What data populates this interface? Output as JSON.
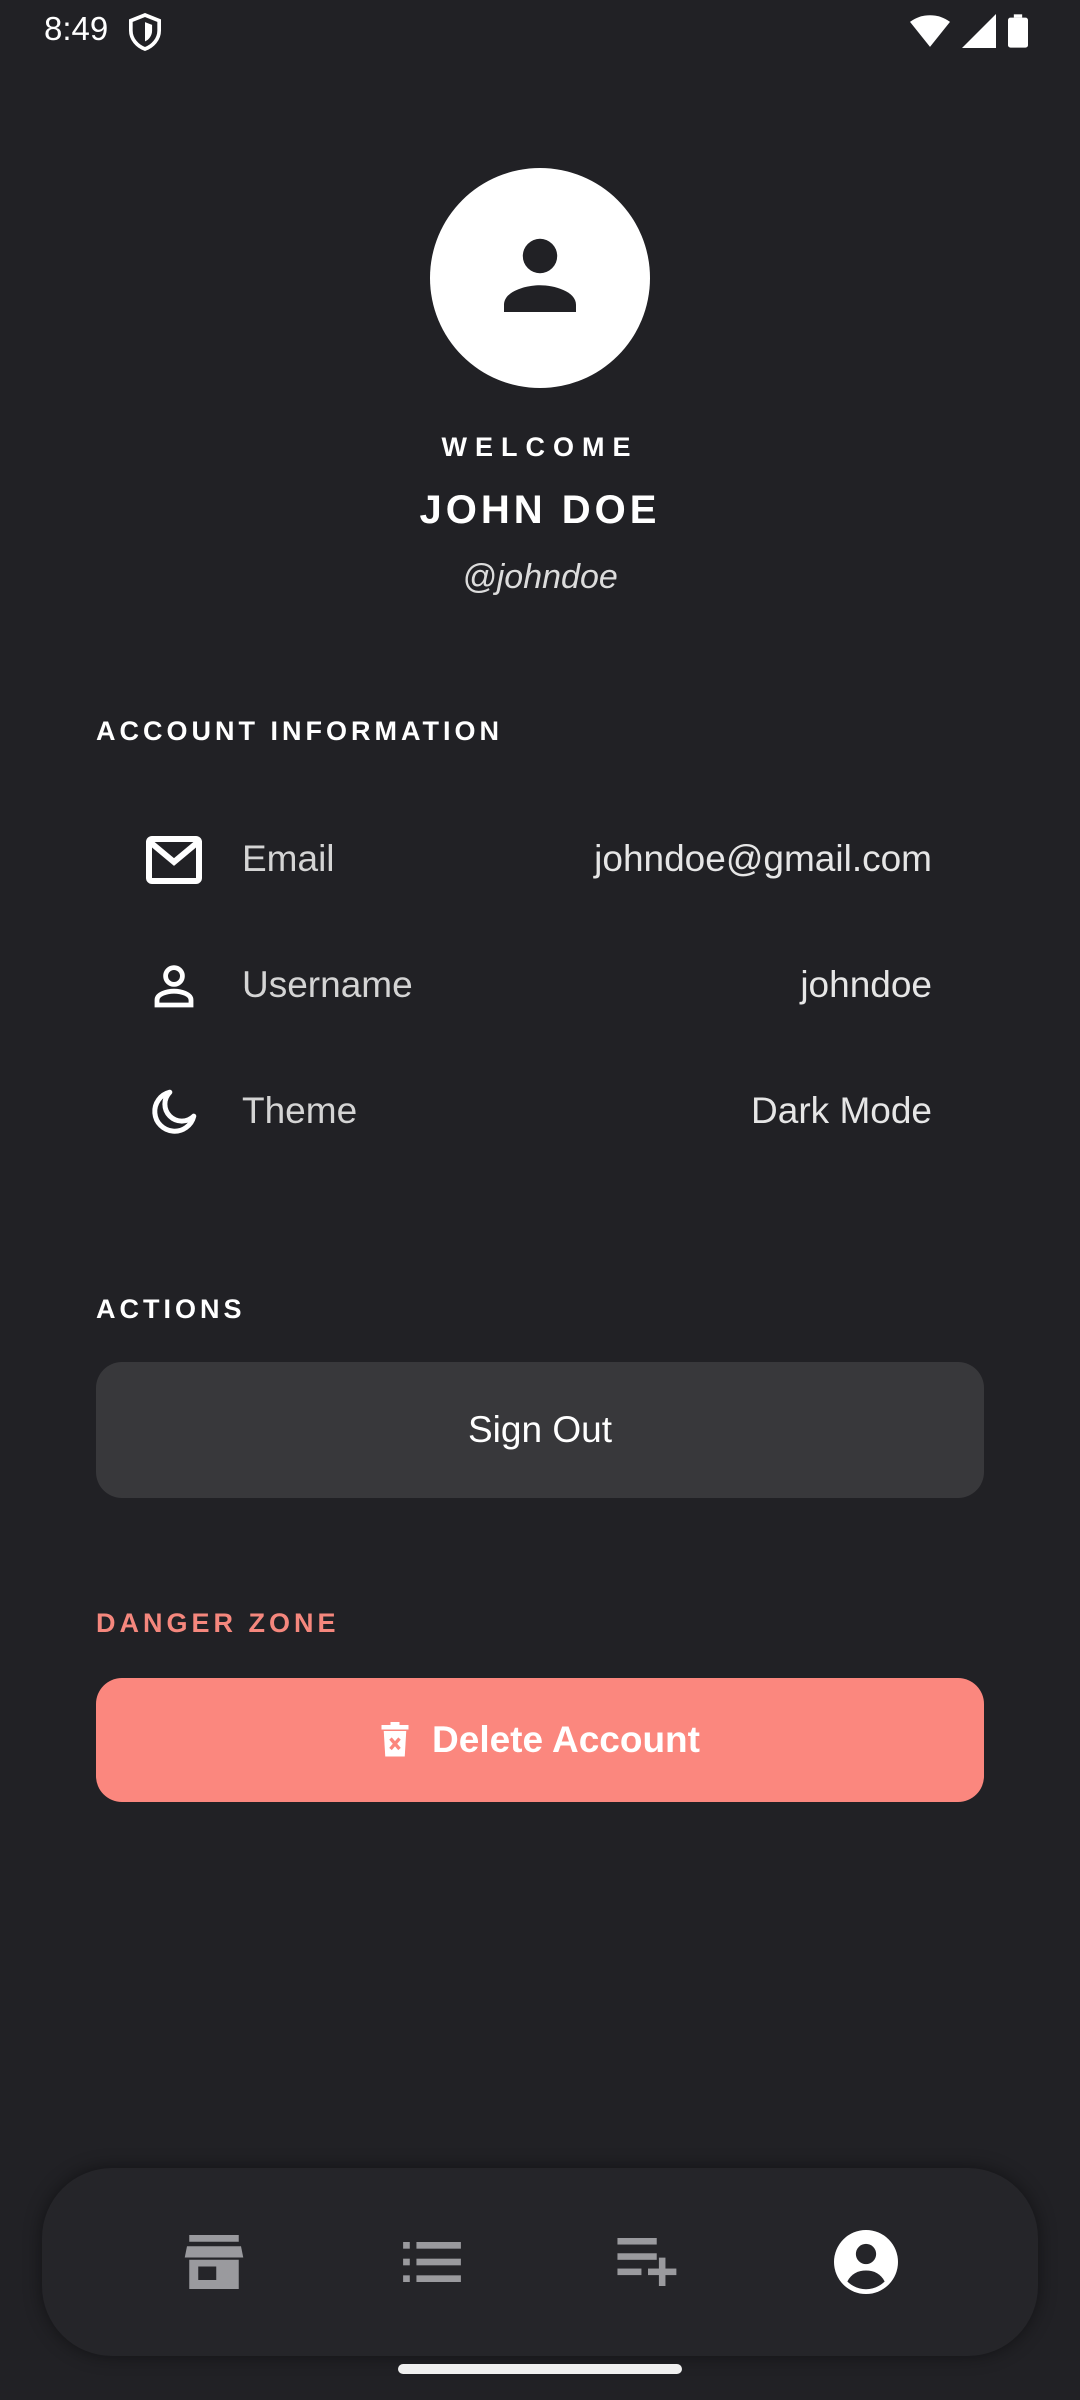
{
  "status_bar": {
    "time": "8:49",
    "icons": [
      "shield-icon",
      "wifi-icon",
      "signal-icon",
      "battery-icon"
    ]
  },
  "profile": {
    "avatar_icon": "person-icon",
    "welcome": "WELCOME",
    "name": "JOHN DOE",
    "handle": "@johndoe"
  },
  "account_info": {
    "title": "ACCOUNT INFORMATION",
    "rows": [
      {
        "icon": "mail-icon",
        "label": "Email",
        "value": "johndoe@gmail.com"
      },
      {
        "icon": "person-outline-icon",
        "label": "Username",
        "value": "johndoe"
      },
      {
        "icon": "moon-icon",
        "label": "Theme",
        "value": "Dark Mode"
      }
    ]
  },
  "actions": {
    "title": "ACTIONS",
    "sign_out_label": "Sign Out"
  },
  "danger_zone": {
    "title": "DANGER ZONE",
    "delete_label": "Delete Account",
    "delete_icon": "trash-icon"
  },
  "bottom_nav": {
    "items": [
      {
        "icon": "store-icon",
        "active": false
      },
      {
        "icon": "list-icon",
        "active": false
      },
      {
        "icon": "playlist-add-icon",
        "active": false
      },
      {
        "icon": "account-circle-icon",
        "active": true
      }
    ]
  },
  "colors": {
    "background": "#212125",
    "danger": "#fb877e",
    "button": "#38383b",
    "nav_inactive": "#9a9a9e",
    "nav_active": "#ffffff"
  }
}
